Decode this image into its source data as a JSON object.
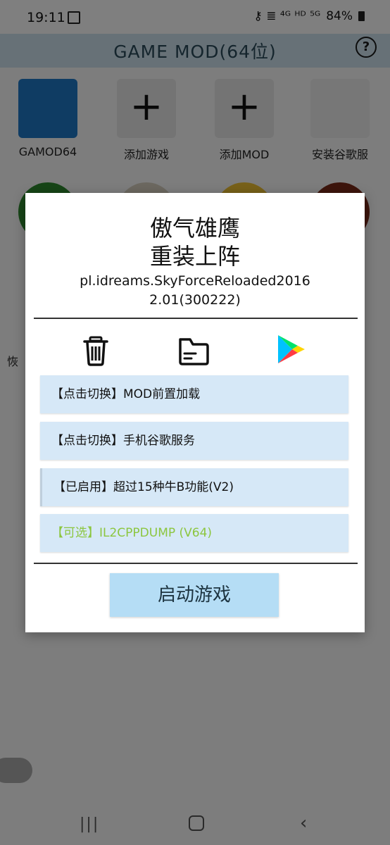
{
  "status_bar": {
    "time": "19:11",
    "indicators": "⚷ ≣ ⁴ᴳ ᴴᴰ ⁵ᴳ",
    "battery": "84%",
    "icons": [
      "gallery-icon",
      "key-icon",
      "wifi-icon",
      "signal-icon",
      "battery-icon"
    ]
  },
  "app_bar": {
    "title": "GAME MOD(64位)",
    "help_glyph": "?"
  },
  "grid": {
    "items": [
      {
        "label": "GAMOD64"
      },
      {
        "label": "添加游戏",
        "glyph": "+"
      },
      {
        "label": "添加MOD",
        "glyph": "+"
      },
      {
        "label": "安装谷歌服"
      }
    ],
    "row2_colors": [
      "#2f8a2f",
      "#d8d0c0",
      "#f1c232",
      "#7a2a18"
    ],
    "side_label": "恢"
  },
  "dialog": {
    "title_line1": "傲气雄鹰",
    "title_line2": "重装上阵",
    "package": "pl.idreams.SkyForceReloaded2016",
    "version": "2.01(300222)",
    "actions": [
      "trash-icon",
      "folder-icon",
      "play-store-icon"
    ],
    "options": [
      {
        "label": "【点击切换】MOD前置加载",
        "color": "#111111"
      },
      {
        "label": "【点击切换】手机谷歌服务",
        "color": "#111111"
      },
      {
        "label": "【已启用】超过15种牛B功能(V2)",
        "color": "#111111"
      },
      {
        "label": "【可选】IL2CPPDUMP (V64)",
        "color": "#8cc63f"
      }
    ],
    "launch_label": "启动游戏"
  },
  "colors": {
    "app_bar": "#cfe3ef",
    "option_bg": "#d6e8f7",
    "launch_bg": "#b5ddf5",
    "optional_text": "#8cc63f"
  }
}
